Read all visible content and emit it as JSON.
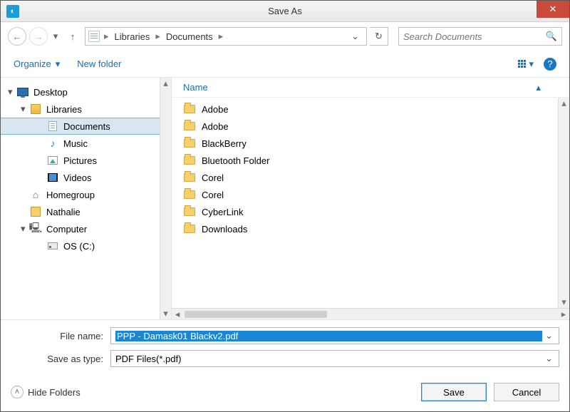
{
  "window": {
    "title": "Save As"
  },
  "nav": {
    "crumbs": [
      "Libraries",
      "Documents"
    ],
    "search_placeholder": "Search Documents"
  },
  "toolbar": {
    "organize_label": "Organize",
    "newfolder_label": "New folder"
  },
  "tree": {
    "items": [
      {
        "label": "Desktop",
        "level": 0,
        "icon": "monitor",
        "expandable": true
      },
      {
        "label": "Libraries",
        "level": 1,
        "icon": "lib",
        "expandable": true
      },
      {
        "label": "Documents",
        "level": 2,
        "icon": "doc",
        "selected": true
      },
      {
        "label": "Music",
        "level": 2,
        "icon": "music"
      },
      {
        "label": "Pictures",
        "level": 2,
        "icon": "pic"
      },
      {
        "label": "Videos",
        "level": 2,
        "icon": "vid"
      },
      {
        "label": "Homegroup",
        "level": 1,
        "icon": "home"
      },
      {
        "label": "Nathalie",
        "level": 1,
        "icon": "user"
      },
      {
        "label": "Computer",
        "level": 1,
        "icon": "comp",
        "expandable": true
      },
      {
        "label": "OS (C:)",
        "level": 2,
        "icon": "drive"
      }
    ]
  },
  "list": {
    "header_name": "Name",
    "items": [
      {
        "name": "Adobe"
      },
      {
        "name": "Adobe"
      },
      {
        "name": "BlackBerry"
      },
      {
        "name": "Bluetooth Folder"
      },
      {
        "name": "Corel"
      },
      {
        "name": "Corel"
      },
      {
        "name": "CyberLink"
      },
      {
        "name": "Downloads"
      }
    ]
  },
  "form": {
    "filename_label": "File name:",
    "filename_value": "PPP - Damask01 Blackv2.pdf",
    "saveastype_label": "Save as type:",
    "saveastype_value": "PDF Files(*.pdf)"
  },
  "footer": {
    "hidefolders_label": "Hide Folders",
    "save_label": "Save",
    "cancel_label": "Cancel"
  }
}
